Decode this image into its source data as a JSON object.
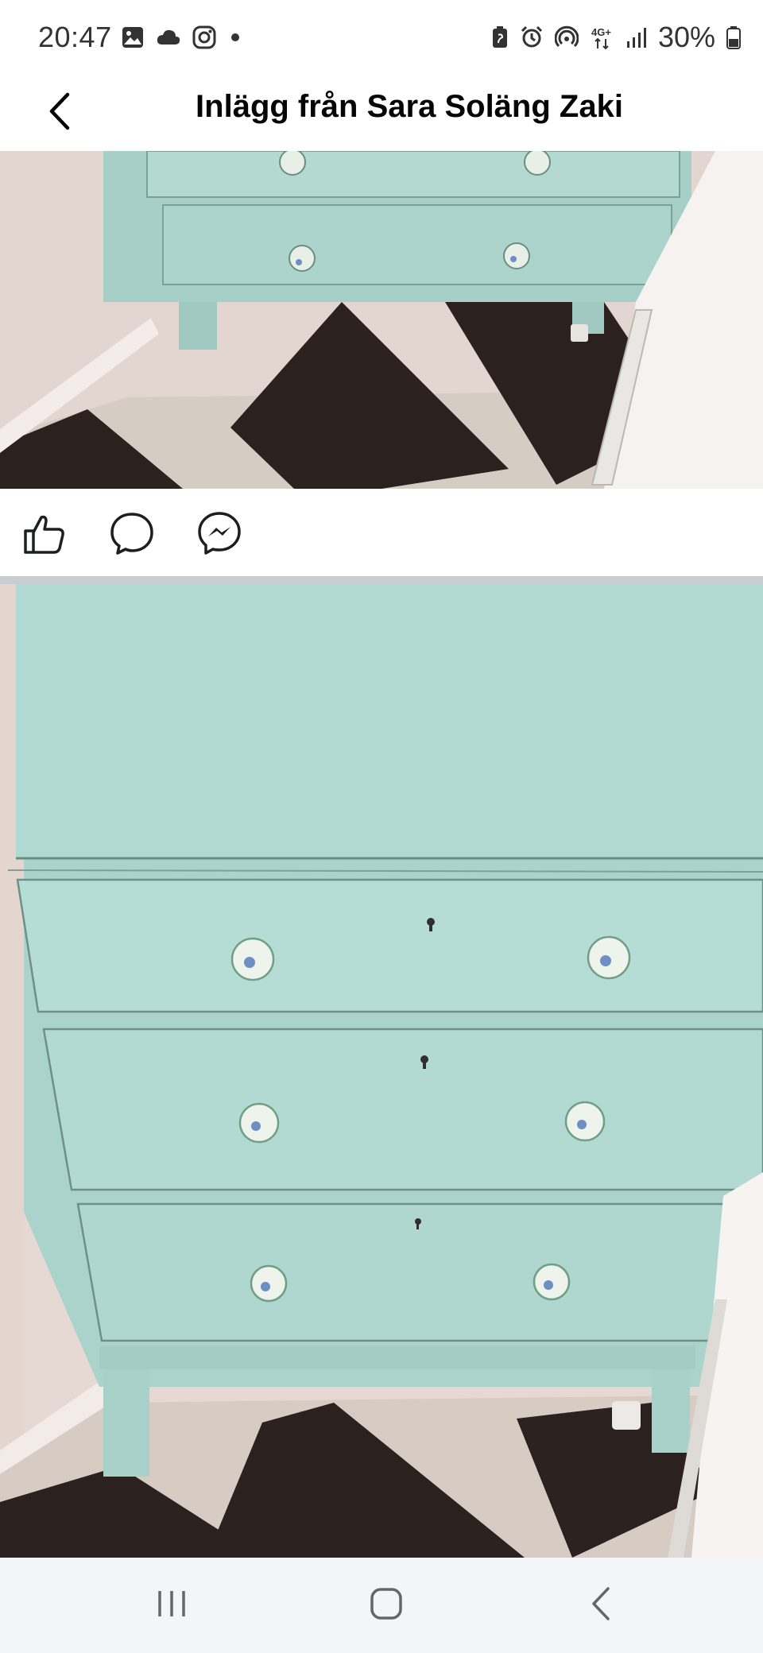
{
  "status_bar": {
    "time": "20:47",
    "left_icons": [
      "gallery-icon",
      "cloud-icon",
      "instagram-icon",
      "dot-icon"
    ],
    "right_icons": [
      "battery-saver-icon",
      "alarm-icon",
      "hotspot-icon",
      "network-4g-plus-icon",
      "signal-icon"
    ],
    "battery_text": "30%"
  },
  "header": {
    "back_icon": "chevron-left-icon",
    "title": "Inlägg från Sara Soläng Zaki"
  },
  "photos": [
    {
      "description_icon": "photo-dresser-top"
    },
    {
      "description_icon": "photo-dresser-full"
    }
  ],
  "actions": {
    "like_icon": "thumbs-up-icon",
    "comment_icon": "comment-icon",
    "share_icon": "messenger-icon"
  },
  "nav_bar": {
    "recents_icon": "recents-icon",
    "home_icon": "home-icon",
    "back_icon": "back-icon"
  },
  "colors": {
    "dresser": "#a9d3cb",
    "floor_dark": "#2b2220",
    "floor_light": "#d6ccc4",
    "wall": "#e8dcd6",
    "divider": "#c9ccd1",
    "navbar": "#f4f5f8"
  }
}
